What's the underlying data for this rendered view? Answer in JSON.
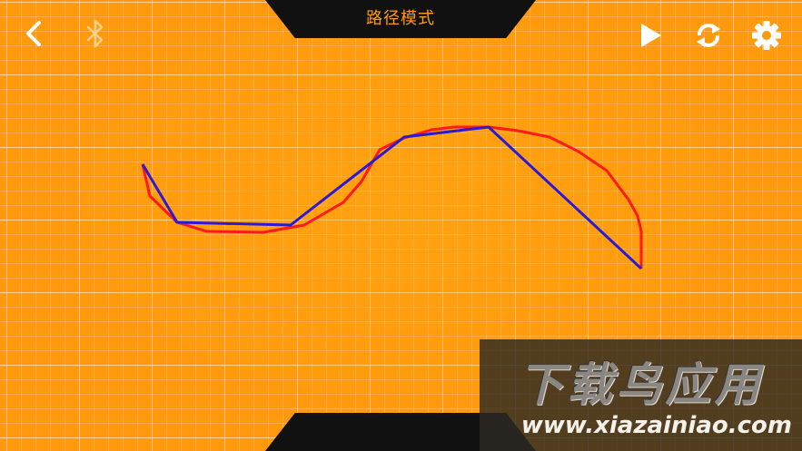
{
  "header": {
    "title": "路径模式"
  },
  "toolbar": {
    "back_icon": "chevron-left-icon",
    "bluetooth_icon": "bluetooth-icon",
    "play_icon": "play-icon",
    "refresh_icon": "sync-icon",
    "settings_icon": "gear-icon"
  },
  "colors": {
    "background": "#ff9a0e",
    "drawn_path": "#ff1a1a",
    "robot_path": "#2a1ad6",
    "tab": "#111111",
    "title_text": "#ff9a0e"
  },
  "watermark": {
    "title": "下载鸟应用",
    "url": "www.xiazainiao.com"
  }
}
